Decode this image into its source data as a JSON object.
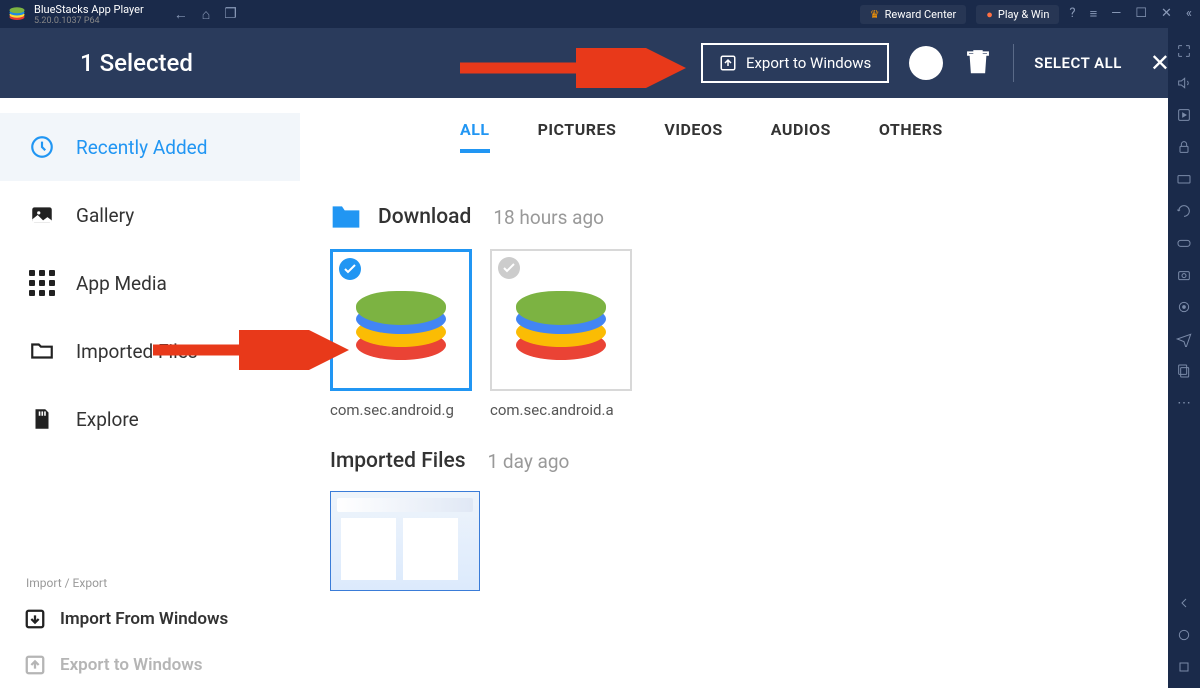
{
  "titlebar": {
    "app_name": "BlueStacks App Player",
    "version": "5.20.0.1037  P64",
    "reward_label": "Reward Center",
    "playwin_label": "Play & Win"
  },
  "selection": {
    "title": "1 Selected",
    "export_label": "Export to Windows",
    "select_all_label": "SELECT ALL"
  },
  "sidebar": {
    "items": [
      {
        "label": "Recently Added"
      },
      {
        "label": "Gallery"
      },
      {
        "label": "App Media"
      },
      {
        "label": "Imported Files"
      },
      {
        "label": "Explore"
      }
    ],
    "footer_label": "Import / Export",
    "import_label": "Import From Windows",
    "export_label": "Export to Windows"
  },
  "tabs": [
    "ALL",
    "PICTURES",
    "VIDEOS",
    "AUDIOS",
    "OTHERS"
  ],
  "sections": [
    {
      "title": "Download",
      "time": "18 hours ago",
      "files": [
        {
          "name": "com.sec.android.g",
          "selected": true
        },
        {
          "name": "com.sec.android.a",
          "selected": false
        }
      ]
    },
    {
      "title": "Imported Files",
      "time": "1 day ago"
    }
  ]
}
